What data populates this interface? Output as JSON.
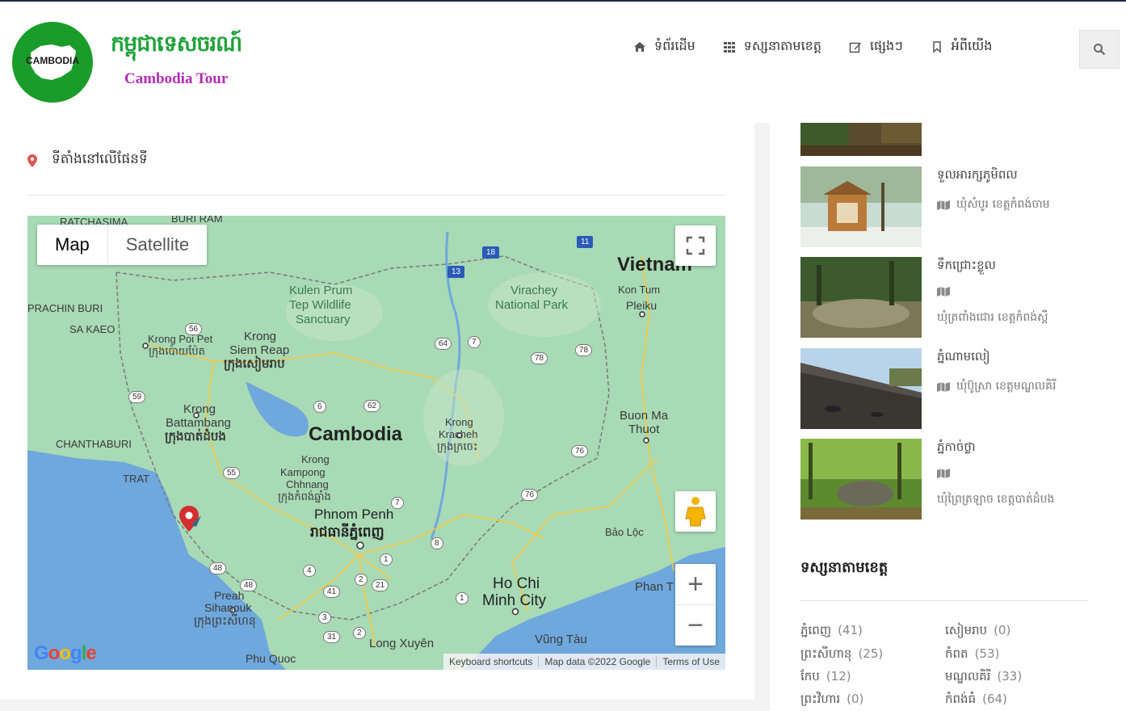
{
  "brand": {
    "title_km": "កម្ពុជាទេសចរណ៍",
    "title_en": "Cambodia Tour",
    "logo_text": "CAMBODIA"
  },
  "nav": {
    "items": [
      {
        "label": "ទំព័រដើម",
        "icon": "home-icon"
      },
      {
        "label": "ទស្សនាតាមខេត្ត",
        "icon": "grid-icon"
      },
      {
        "label": "ផ្សេងៗ",
        "icon": "edit-icon"
      },
      {
        "label": "អំពីយើង",
        "icon": "bookmark-icon"
      }
    ],
    "search_icon": "search-icon"
  },
  "location": {
    "label": "ទីតាំងនៅលើផែនទី",
    "icon": "map-pin-icon"
  },
  "map": {
    "type_buttons": [
      "Map",
      "Satellite"
    ],
    "selected": "Map",
    "zoom_in": "+",
    "zoom_out": "−",
    "attribution": [
      "Keyboard shortcuts",
      "Map data ©2022 Google",
      "Terms of Use"
    ],
    "google_logo": "Google",
    "labels": {
      "vietnam": "Vietnam",
      "cambodia": "Cambodia",
      "kulen1": "Kulen Prum",
      "kulen2": "Tep Wildlife",
      "kulen3": "Sanctuary",
      "virachey1": "Virachey",
      "virachey2": "National Park",
      "buriram": "BURI RAM",
      "ratchasima": "RATCHASIMA",
      "prachinburi": "PRACHIN BURI",
      "sakaeo": "SA KAEO",
      "chanthaburi": "CHANTHABURI",
      "trat": "TRAT",
      "krongpoipet1": "Krong Poi Pet",
      "krongpoipet2": "ក្រុងប៉ោយប៉ែត",
      "siemreap1": "Krong",
      "siemreap2": "Siem Reap",
      "siemreap3": "ក្រុងសៀមរាប",
      "battambang1": "Krong",
      "battambang2": "Battambang",
      "battambang3": "ក្រុងបាត់ដំបង",
      "kampong1": "Krong",
      "kampong2": "Kampong",
      "kampong3": "Chhnang",
      "kampong4": "ក្រុងកំពង់ឆ្នាំង",
      "kratie1": "Krong",
      "kratie2": "Kracheh",
      "kratie3": "ក្រុងក្រចេះ",
      "phnompenh1": "Phnom Penh",
      "phnompenh2": "រាជធានីភ្នំពេញ",
      "kontum": "Kon Tum",
      "pleiku": "Pleiku",
      "buonmathuot1": "Buon Ma",
      "buonmathuot2": "Thuot",
      "baoloc": "Bảo Lộc",
      "phant": "Phan T",
      "hochiminh1": "Ho Chi",
      "hochiminh2": "Minh City",
      "vungtau": "Vũng Tàu",
      "longxuyen": "Long Xuyên",
      "phuquoc": "Phu Quoc",
      "sihanouk1": "Preah",
      "sihanouk2": "Sihanouk",
      "sihanouk3": "ក្រុងព្រះសីហនុ"
    },
    "road_shields": [
      "56",
      "59",
      "55",
      "48",
      "48",
      "64",
      "7",
      "78",
      "78",
      "62",
      "6",
      "76",
      "76",
      "7",
      "8",
      "1",
      "4",
      "41",
      "21",
      "2",
      "3",
      "31",
      "2",
      "1",
      "18",
      "11",
      "13"
    ]
  },
  "sidebar": {
    "items": [
      {
        "title": "ទួលអារក្សភូមិពល",
        "location": "ឃុំសំបូរ ខេត្តកំពង់ចាម"
      },
      {
        "title": "ទឹកជ្រោះខ្លួល",
        "location": "ឃុំត្រពាំងជោរ ខេត្តកំពង់ស្ពឺ"
      },
      {
        "title": "ភ្នំណាមលៀ",
        "location": "ឃុំប៊ូស្រា ខេត្តមណ្ឌលគិរី"
      },
      {
        "title": "ភ្នំកាច់ថ្លា",
        "location": "ឃុំព្រៃត្រឡាច ខេត្តបាត់ដំបង"
      }
    ],
    "section_title": "ទស្សនាតាមខេត្ត",
    "provinces": [
      {
        "name": "ភ្នំពេញ",
        "count": "(41)"
      },
      {
        "name": "សៀមរាប",
        "count": "(0)"
      },
      {
        "name": "ព្រះសីហានុ",
        "count": "(25)"
      },
      {
        "name": "កំពត",
        "count": "(53)"
      },
      {
        "name": "កែប",
        "count": "(12)"
      },
      {
        "name": "មណ្ឌលគិរី",
        "count": "(33)"
      },
      {
        "name": "ព្រះវិហារ",
        "count": "(0)"
      },
      {
        "name": "កំពង់ធំ",
        "count": "(64)"
      }
    ]
  },
  "colors": {
    "brand_green": "#1fa23a",
    "brand_purple": "#b22cb5",
    "map_land": "#a8dab5",
    "map_water": "#6fa8dc",
    "pin": "#d32f2f"
  }
}
